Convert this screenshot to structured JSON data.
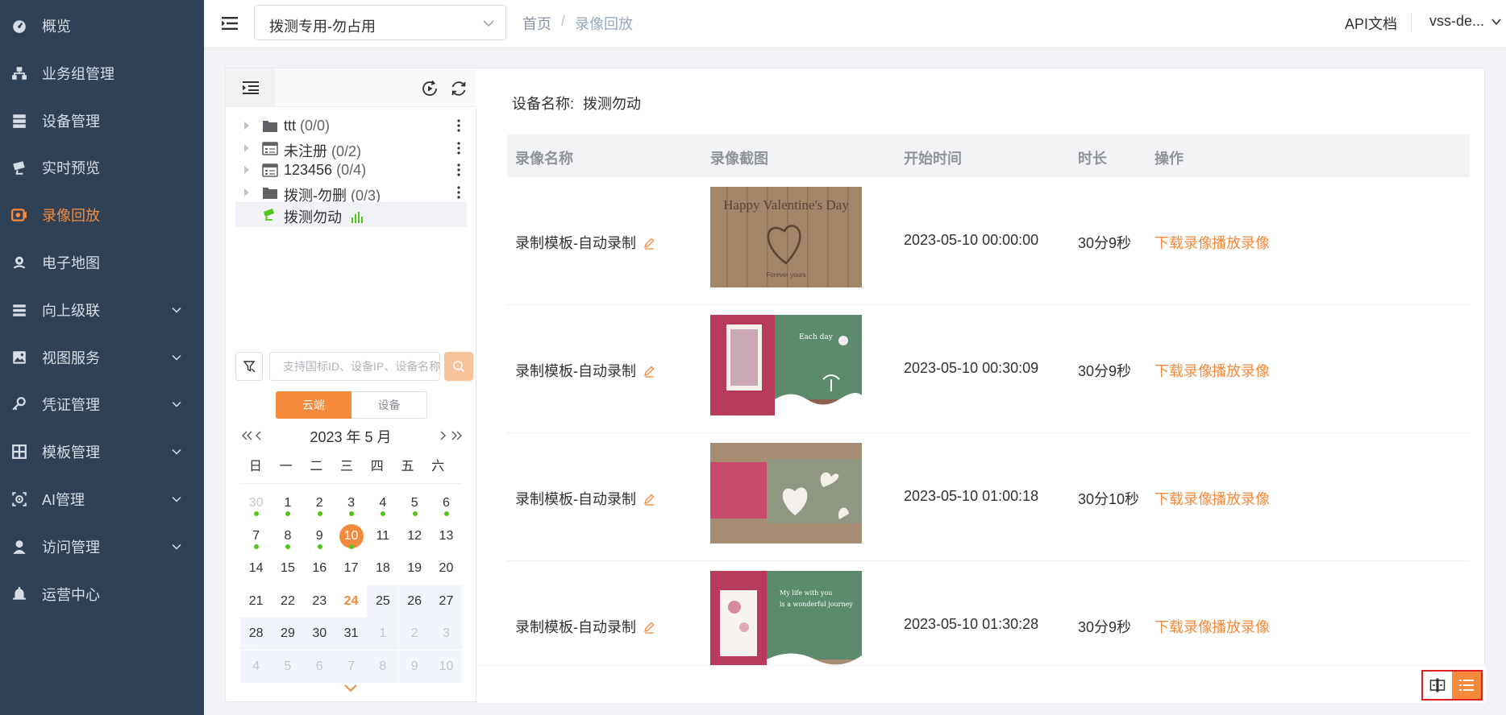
{
  "sidebar": {
    "items": [
      {
        "label": "概览",
        "icon": "dashboard-icon"
      },
      {
        "label": "业务组管理",
        "icon": "org-tree-icon"
      },
      {
        "label": "设备管理",
        "icon": "server-icon"
      },
      {
        "label": "实时预览",
        "icon": "live-icon"
      },
      {
        "label": "录像回放",
        "icon": "playback-icon"
      },
      {
        "label": "电子地图",
        "icon": "map-pin-icon"
      },
      {
        "label": "向上级联",
        "icon": "cascade-icon"
      },
      {
        "label": "视图服务",
        "icon": "image-icon"
      },
      {
        "label": "凭证管理",
        "icon": "key-icon"
      },
      {
        "label": "模板管理",
        "icon": "grid-icon"
      },
      {
        "label": "AI管理",
        "icon": "ai-icon"
      },
      {
        "label": "访问管理",
        "icon": "user-icon"
      },
      {
        "label": "运营中心",
        "icon": "bell-icon"
      }
    ],
    "active_index": 4,
    "accent_color": "#f58a3d",
    "background_color": "#304156"
  },
  "header": {
    "project_select": "拨测专用-勿占用",
    "breadcrumb": [
      "首页",
      "录像回放"
    ],
    "api_doc": "API文档",
    "user": "vss-de..."
  },
  "tree": {
    "nodes": [
      {
        "name": "ttt",
        "count": "(0/0)",
        "icon": "folder-icon"
      },
      {
        "name": "未注册",
        "count": "(0/2)",
        "icon": "nvr-icon"
      },
      {
        "name": "123456",
        "count": "(0/4)",
        "icon": "nvr-icon"
      },
      {
        "name": "拨测-勿删",
        "count": "(0/3)",
        "icon": "folder-icon"
      },
      {
        "name": "拨测勿动",
        "count": "",
        "icon": "camera-icon"
      }
    ]
  },
  "search": {
    "placeholder": "支持国标ID、设备IP、设备名称"
  },
  "storage_tabs": [
    "云端",
    "设备"
  ],
  "calendar": {
    "title": "2023 年  5 月",
    "weekdays": [
      "日",
      "一",
      "二",
      "三",
      "四",
      "五",
      "六"
    ],
    "days": [
      {
        "d": "30",
        "o": true,
        "dot": true
      },
      {
        "d": "1",
        "dot": true
      },
      {
        "d": "2",
        "dot": true
      },
      {
        "d": "3",
        "dot": true
      },
      {
        "d": "4",
        "dot": true
      },
      {
        "d": "5",
        "dot": true
      },
      {
        "d": "6",
        "dot": true
      },
      {
        "d": "7",
        "dot": true
      },
      {
        "d": "8",
        "dot": true
      },
      {
        "d": "9",
        "dot": true
      },
      {
        "d": "10",
        "sel": true,
        "dot": true
      },
      {
        "d": "11"
      },
      {
        "d": "12"
      },
      {
        "d": "13"
      },
      {
        "d": "14"
      },
      {
        "d": "15"
      },
      {
        "d": "16"
      },
      {
        "d": "17"
      },
      {
        "d": "18"
      },
      {
        "d": "19"
      },
      {
        "d": "20"
      },
      {
        "d": "21"
      },
      {
        "d": "22"
      },
      {
        "d": "23"
      },
      {
        "d": "24",
        "today": true
      },
      {
        "d": "25",
        "g": true
      },
      {
        "d": "26",
        "g": true
      },
      {
        "d": "27",
        "g": true
      },
      {
        "d": "28",
        "g": true
      },
      {
        "d": "29",
        "g": true
      },
      {
        "d": "30",
        "g": true
      },
      {
        "d": "31",
        "g": true
      },
      {
        "d": "1",
        "o": true,
        "g": true
      },
      {
        "d": "2",
        "o": true,
        "g": true
      },
      {
        "d": "3",
        "o": true,
        "g": true
      },
      {
        "d": "4",
        "o": true,
        "g": true
      },
      {
        "d": "5",
        "o": true,
        "g": true
      },
      {
        "d": "6",
        "o": true,
        "g": true
      },
      {
        "d": "7",
        "o": true,
        "g": true
      },
      {
        "d": "8",
        "o": true,
        "g": true
      },
      {
        "d": "9",
        "o": true,
        "g": true
      },
      {
        "d": "10",
        "o": true,
        "g": true
      }
    ]
  },
  "content": {
    "device_label": "设备名称:",
    "device_name": "拨测勿动",
    "columns": [
      "录像名称",
      "录像截图",
      "开始时间",
      "时长",
      "操作"
    ],
    "rows": [
      {
        "name": "录制模板-自动录制",
        "start": "2023-05-10 00:00:00",
        "duration": "30分9秒",
        "thumb": "valentine"
      },
      {
        "name": "录制模板-自动录制",
        "start": "2023-05-10 00:30:09",
        "duration": "30分9秒",
        "thumb": "card-green"
      },
      {
        "name": "录制模板-自动录制",
        "start": "2023-05-10 01:00:18",
        "duration": "30分10秒",
        "thumb": "hearts"
      },
      {
        "name": "录制模板-自动录制",
        "start": "2023-05-10 01:30:28",
        "duration": "30分9秒",
        "thumb": "card-journey"
      }
    ],
    "actions": {
      "download": "下载录像",
      "play": "播放录像"
    },
    "thumb_texts": {
      "valentine": "Happy Valentine's Day",
      "valentine_sub": "Forever yours",
      "each_day": "Each day",
      "journey_1": "My life with you",
      "journey_2": "is a wonderful journey"
    }
  }
}
